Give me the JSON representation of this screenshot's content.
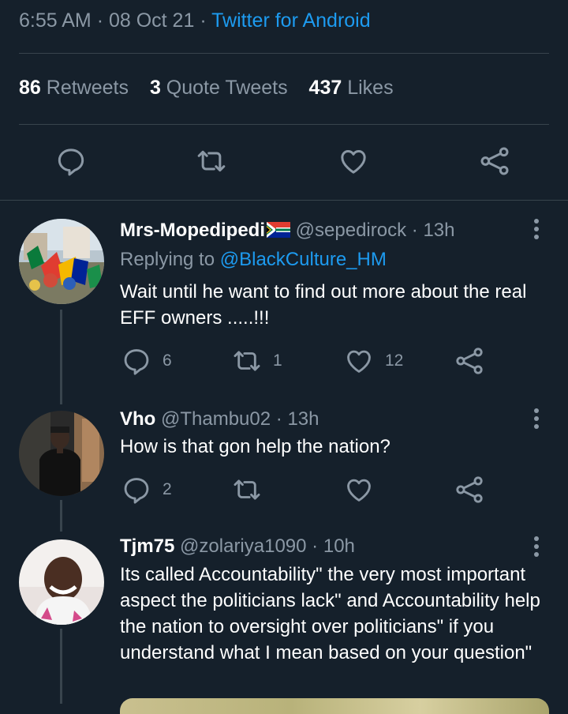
{
  "tweet": {
    "time": "6:55 AM",
    "date": "08 Oct 21",
    "separator": "·",
    "client": "Twitter for Android",
    "retweets_count": "86",
    "retweets_label": "Retweets",
    "quote_count": "3",
    "quote_label": "Quote Tweets",
    "likes_count": "437",
    "likes_label": "Likes"
  },
  "replies": [
    {
      "name": "Mrs-Mopedipedi",
      "flag": "south-africa-flag",
      "handle": "@sepedirock",
      "time": "13h",
      "replying_prefix": "Replying to",
      "replying_to": "@BlackCulture_HM",
      "text": "Wait until he want to find out more about the real EFF owners .....!!!",
      "reply_count": "6",
      "retweet_count": "1",
      "like_count": "12"
    },
    {
      "name": "Vho",
      "handle": "@Thambu02",
      "time": "13h",
      "text": "How is that gon help the nation?",
      "reply_count": "2",
      "retweet_count": "",
      "like_count": ""
    },
    {
      "name": "Tjm75",
      "handle": "@zolariya1090",
      "time": "10h",
      "text": "Its called Accountability\" the very most important aspect the politicians lack\" and Accountability help the nation to oversight over politicians\" if you understand what I mean based on your question\""
    }
  ],
  "icons": [
    "reply-icon",
    "retweet-icon",
    "like-icon",
    "share-icon",
    "more-icon"
  ],
  "colors": {
    "background": "#15202b",
    "accent": "#1d9bf0",
    "muted": "#8b98a5",
    "divider": "#38444d"
  }
}
